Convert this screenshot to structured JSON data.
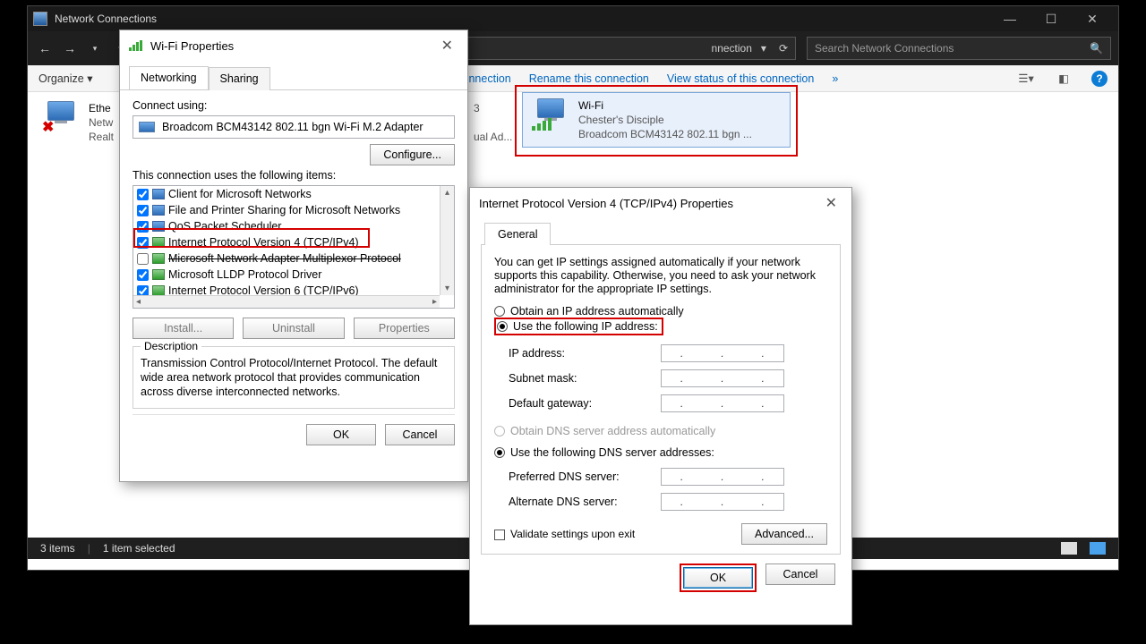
{
  "window": {
    "title": "Network Connections",
    "address_tail": "nnection",
    "search_placeholder": "Search Network Connections"
  },
  "cmdbar": {
    "organize": "Organize",
    "disable": "nnection",
    "rename": "Rename this connection",
    "viewstatus": "View status of this connection",
    "more": "»"
  },
  "adapters": {
    "eth": {
      "name": "Ethe",
      "line2": "Netw",
      "line3": "Realt"
    },
    "mid": {
      "line1": "3",
      "line2": "ual Ad..."
    },
    "wifi": {
      "name": "Wi-Fi",
      "ssid": "Chester's Disciple",
      "device": "Broadcom BCM43142 802.11 bgn ..."
    }
  },
  "status": {
    "count": "3 items",
    "selected": "1 item selected"
  },
  "wifiprops": {
    "title": "Wi-Fi Properties",
    "tab_networking": "Networking",
    "tab_sharing": "Sharing",
    "connect_using": "Connect using:",
    "adapter": "Broadcom BCM43142 802.11 bgn Wi-Fi M.2 Adapter",
    "configure": "Configure...",
    "items_label": "This connection uses the following items:",
    "items": [
      {
        "label": "Client for Microsoft Networks",
        "checked": true
      },
      {
        "label": "File and Printer Sharing for Microsoft Networks",
        "checked": true
      },
      {
        "label": "QoS Packet Scheduler",
        "checked": true
      },
      {
        "label": "Internet Protocol Version 4 (TCP/IPv4)",
        "checked": true
      },
      {
        "label": "Microsoft Network Adapter Multiplexor Protocol",
        "checked": false
      },
      {
        "label": "Microsoft LLDP Protocol Driver",
        "checked": true
      },
      {
        "label": "Internet Protocol Version 6 (TCP/IPv6)",
        "checked": true
      }
    ],
    "install": "Install...",
    "uninstall": "Uninstall",
    "properties": "Properties",
    "desc_label": "Description",
    "desc_text": "Transmission Control Protocol/Internet Protocol. The default wide area network protocol that provides communication across diverse interconnected networks.",
    "ok": "OK",
    "cancel": "Cancel"
  },
  "ipdlg": {
    "title": "Internet Protocol Version 4 (TCP/IPv4) Properties",
    "tab_general": "General",
    "info": "You can get IP settings assigned automatically if your network supports this capability. Otherwise, you need to ask your network administrator for the appropriate IP settings.",
    "opt_auto_ip": "Obtain an IP address automatically",
    "opt_use_ip": "Use the following IP address:",
    "ip_address": "IP address:",
    "subnet": "Subnet mask:",
    "gateway": "Default gateway:",
    "opt_auto_dns": "Obtain DNS server address automatically",
    "opt_use_dns": "Use the following DNS server addresses:",
    "pref_dns": "Preferred DNS server:",
    "alt_dns": "Alternate DNS server:",
    "validate": "Validate settings upon exit",
    "advanced": "Advanced...",
    "ok": "OK",
    "cancel": "Cancel"
  }
}
